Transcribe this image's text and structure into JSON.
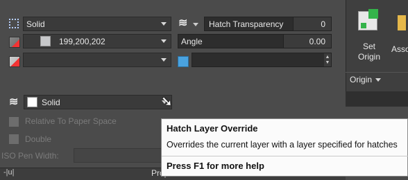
{
  "panel": {
    "hatch_type": "Solid",
    "color_value": "199,200,202",
    "background_color_value": "",
    "hatch_transparency_label": "Hatch Transparency",
    "hatch_transparency_value": "0",
    "angle_label": "Angle",
    "angle_value": "0.00",
    "layer_override_value": "Solid",
    "relative_to_paper_space_label": "Relative To Paper Space",
    "double_label": "Double",
    "iso_pen_width_label": "ISO Pen Width:",
    "properties_title": "Properties",
    "pin_icon_label": "-|u|"
  },
  "origin": {
    "set_origin_label": "Set\nOrigin",
    "associative_label": "Asso",
    "origin_dropdown_label": "Origin"
  },
  "tooltip": {
    "title": "Hatch Layer Override",
    "description": "Overrides the current layer with a layer specified for hatches",
    "help": "Press F1 for more help"
  },
  "colors": {
    "panel_bg": "#4b4b4b",
    "field_bg": "#3a3a3a",
    "tooltip_bg": "#fbfbfb",
    "swatch_color": "#c7c8ca"
  },
  "icons": [
    "hatch-type-icon",
    "hatch-color-icon",
    "background-color-icon",
    "transparency-icon",
    "angle-icon",
    "layer-icon",
    "paper-space-icon",
    "double-icon",
    "set-origin-icon",
    "associative-icon",
    "cursor-icon"
  ]
}
